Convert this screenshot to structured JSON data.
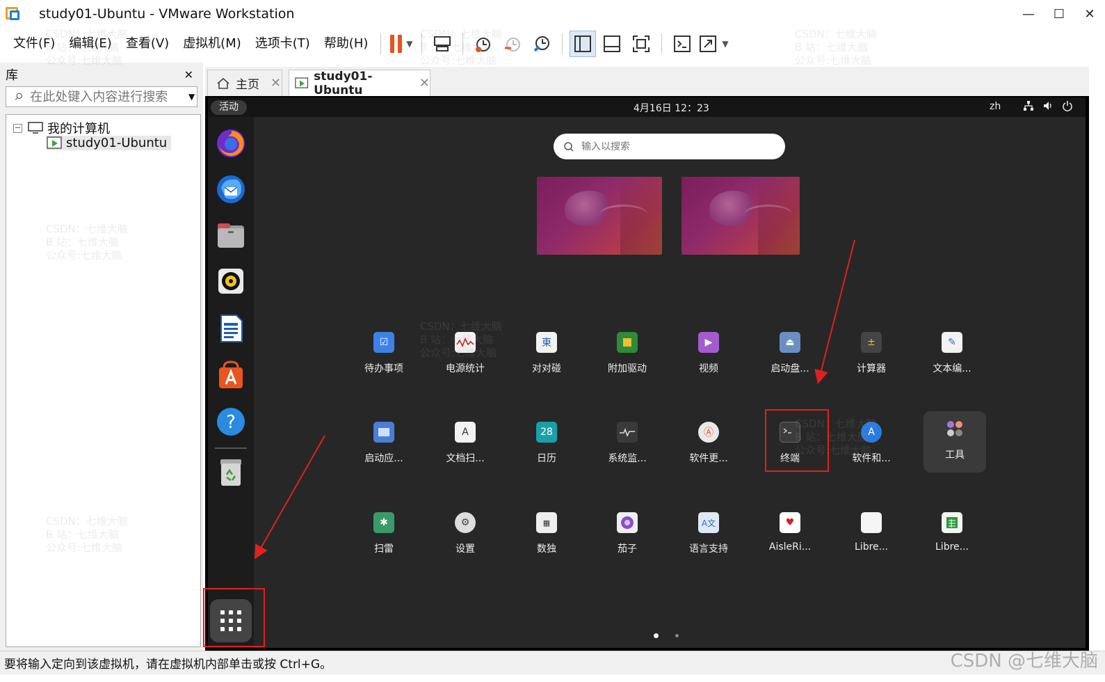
{
  "window": {
    "title": "study01-Ubuntu - VMware Workstation",
    "minimize": "—",
    "maximize": "☐",
    "close": "✕"
  },
  "menu": [
    "文件(F)",
    "编辑(E)",
    "查看(V)",
    "虚拟机(M)",
    "选项卡(T)",
    "帮助(H)"
  ],
  "library": {
    "title": "库",
    "close": "✕",
    "search_placeholder": "在此处键入内容进行搜索",
    "tree_root": "我的计算机",
    "tree_root_toggle": "−",
    "tree_vm": "study01-Ubuntu"
  },
  "tabs": [
    {
      "label": "主页",
      "close": "✕"
    },
    {
      "label": "study01-Ubuntu",
      "close": "✕"
    }
  ],
  "ubuntu": {
    "activities": "活动",
    "clock": "4月16日  12：23",
    "lang": "zh",
    "search_placeholder": "输入以搜索",
    "dock": [
      "firefox-icon",
      "thunderbird-icon",
      "files-icon",
      "rhythmbox-icon",
      "writer-icon",
      "app-center-icon",
      "help-icon",
      "trash-icon"
    ],
    "apps_row1": [
      "待办事项",
      "电源统计",
      "对对碰",
      "附加驱动",
      "视频",
      "启动盘...",
      "计算器",
      "文本编..."
    ],
    "apps_row2": [
      "启动应...",
      "文档扫...",
      "日历",
      "系统监...",
      "软件更...",
      "终端",
      "软件和...",
      "工具"
    ],
    "apps_row3": [
      "扫雷",
      "设置",
      "数独",
      "茄子",
      "语言支持",
      "AisleRi...",
      "Libre...",
      "Libre..."
    ],
    "calendar_day": "28",
    "mahjongg_glyph": "東"
  },
  "status": "要将输入定向到该虚拟机，请在虚拟机内部单击或按 Ctrl+G。",
  "watermark": {
    "lines": "CSDN：七维大脑\nB 站：七维大脑\n公众号:七维大脑",
    "corner": "CSDN @七维大脑"
  },
  "colors": {
    "highlight": "#e02020",
    "pause_orange": "#e8531e",
    "ubuntu_bg": "#272727"
  }
}
